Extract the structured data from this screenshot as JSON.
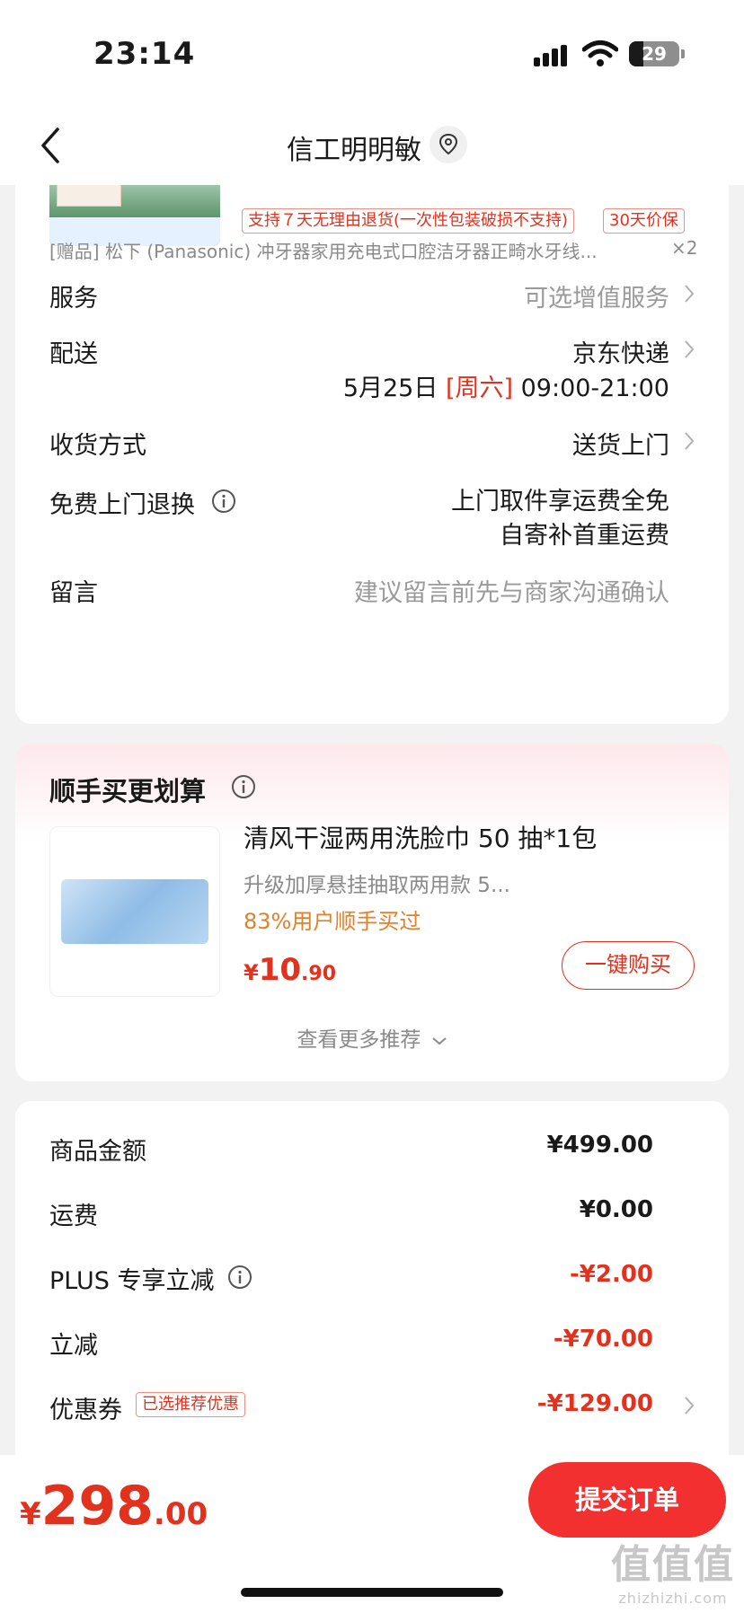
{
  "status_bar": {
    "time": "23:14",
    "battery": "29",
    "battery_level": 0.29
  },
  "nav": {
    "title": "信工明明敏"
  },
  "order_item": {
    "tags": [
      "支持７天无理由退货(一次性包装破损不支持)",
      "30天价保"
    ],
    "gift": "[赠品] 松下 (Panasonic) 冲牙器家用充电式口腔洁牙器正畸水牙线...",
    "gift_qty": "×2"
  },
  "details": {
    "service_label": "服务",
    "service_value": "可选增值服务",
    "delivery_label": "配送",
    "delivery_value": "京东快递",
    "delivery_date": "5月25日",
    "delivery_day": "[周六]",
    "delivery_time": "09:00-21:00",
    "receive_label": "收货方式",
    "receive_value": "送货上门",
    "return_label": "免费上门退换",
    "return_line1": "上门取件享运费全免",
    "return_line2": "自寄补首重运费",
    "message_label": "留言",
    "message_placeholder": "建议留言前先与商家沟通确认"
  },
  "recommendation": {
    "title": "顺手买更划算",
    "product_name": "清风干湿两用洗脸巾 50 抽*1包",
    "product_desc": "升级加厚悬挂抽取两用款 5...",
    "buy_ratio": "83%用户顺手买过",
    "price_currency": "¥",
    "price_int": "10",
    "price_dec": ".90",
    "buy_button": "一键购买",
    "more": "查看更多推荐"
  },
  "summary": {
    "goods_label": "商品金额",
    "goods_value": "¥499.00",
    "shipping_label": "运费",
    "shipping_value": "¥0.00",
    "plus_label": "PLUS 专享立减",
    "plus_value": "-¥2.00",
    "discount_label": "立减",
    "discount_value": "-¥70.00",
    "coupon_label": "优惠券",
    "coupon_tag": "已选推荐优惠",
    "coupon_value": "-¥129.00"
  },
  "footer": {
    "total_currency": "¥",
    "total_int": "298",
    "total_dec": ".00",
    "submit": "提交订单"
  },
  "watermark": {
    "big": "值值值",
    "small": "zhizhizhi.com"
  },
  "colors": {
    "accent": "#e2321e",
    "submit": "#f23030",
    "highlight": "#e3802a"
  }
}
